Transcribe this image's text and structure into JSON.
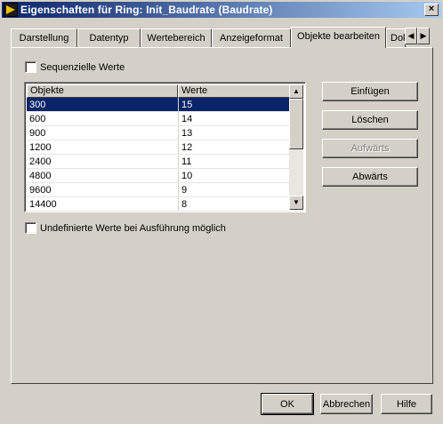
{
  "window": {
    "title": "Eigenschaften für Ring: Init_Baudrate (Baudrate)",
    "close_label": "×"
  },
  "tabs": [
    {
      "label": "Darstellung"
    },
    {
      "label": "Datentyp"
    },
    {
      "label": "Wertebereich"
    },
    {
      "label": "Anzeigeformat"
    },
    {
      "label": "Objekte bearbeiten",
      "active": true
    },
    {
      "label": "Dok"
    }
  ],
  "tab_scroll": {
    "left": "◀",
    "right": "▶"
  },
  "options": {
    "sequential_label": "Sequenzielle Werte",
    "sequential_checked": false,
    "undefined_label": "Undefinierte Werte bei Ausführung möglich",
    "undefined_checked": false
  },
  "list": {
    "columns": [
      "Objekte",
      "Werte"
    ],
    "rows": [
      {
        "object": "300",
        "value": "15"
      },
      {
        "object": "600",
        "value": "14"
      },
      {
        "object": "900",
        "value": "13"
      },
      {
        "object": "1200",
        "value": "12"
      },
      {
        "object": "2400",
        "value": "11"
      },
      {
        "object": "4800",
        "value": "10"
      },
      {
        "object": "9600",
        "value": "9"
      },
      {
        "object": "14400",
        "value": "8"
      }
    ],
    "selected_index": 0,
    "scroll_up": "▲",
    "scroll_down": "▼"
  },
  "actions": {
    "insert": "Einfügen",
    "delete": "Löschen",
    "up": "Aufwärts",
    "down": "Abwärts"
  },
  "footer": {
    "ok": "OK",
    "cancel": "Abbrechen",
    "help": "Hilfe"
  },
  "colors": {
    "titlebar_start": "#0a246a",
    "titlebar_end": "#a6caf0",
    "selection": "#0a246a",
    "face": "#d4d0c8"
  }
}
